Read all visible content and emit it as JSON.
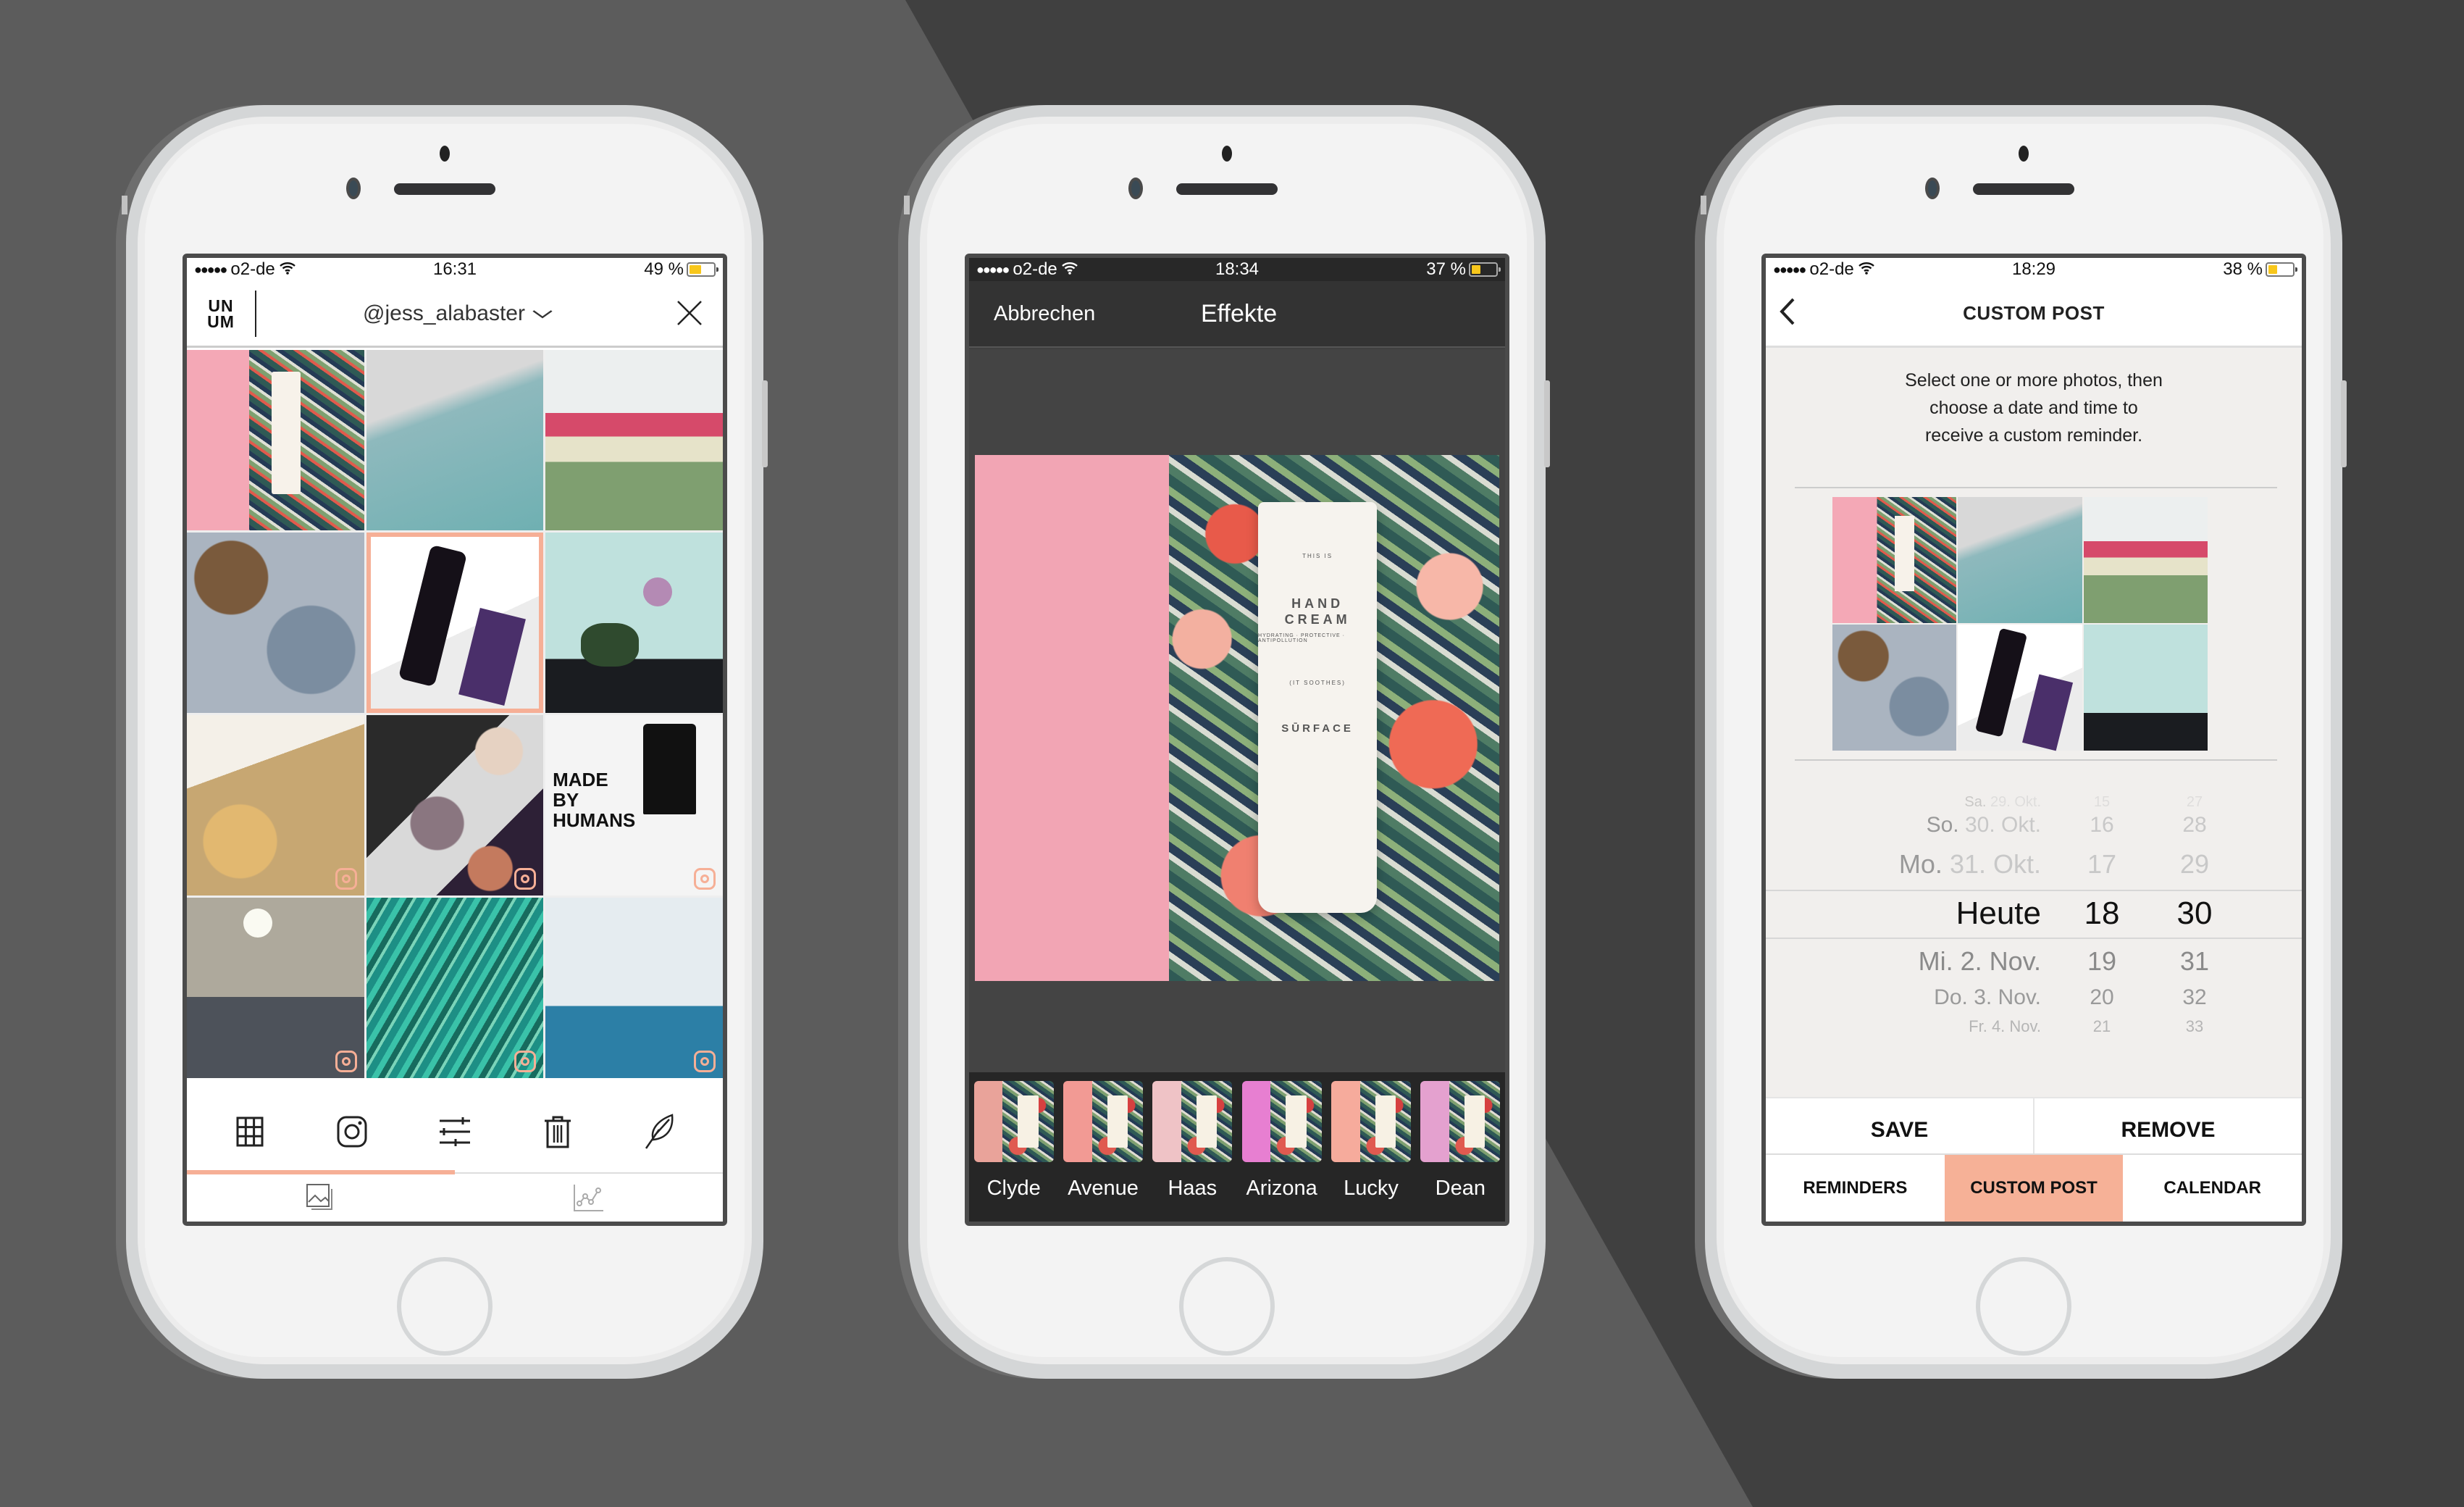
{
  "colors": {
    "accent_peach": "#f6af96",
    "background_light": "#5c5c5c",
    "background_dark": "#404040",
    "battery_fill": "#f8c71b"
  },
  "phones": [
    {
      "status": {
        "carrier": "o2-de",
        "signal_dots": "●●●●●",
        "time": "16:31",
        "battery_text": "49 %",
        "battery_level": 0.49
      },
      "header": {
        "logo_top": "UN",
        "logo_bottom": "UM",
        "account": "@jess_alabaster",
        "account_chevron": "chevron-down-icon",
        "close_icon": "close-icon"
      },
      "grid": {
        "cells": [
          {
            "name": "hand-cream-tropical",
            "selected": false,
            "instagram": false
          },
          {
            "name": "ocean-rock",
            "selected": false,
            "instagram": false
          },
          {
            "name": "juice-bottles-fan",
            "selected": false,
            "instagram": false
          },
          {
            "name": "dog-knitting",
            "selected": false,
            "instagram": false
          },
          {
            "name": "amly-face-mist",
            "selected": true,
            "instagram": false
          },
          {
            "name": "flowers-table",
            "selected": false,
            "instagram": false
          },
          {
            "name": "baldini-perfume",
            "selected": false,
            "instagram": true
          },
          {
            "name": "makeup-marble",
            "selected": false,
            "instagram": true
          },
          {
            "name": "made-by-humans-boot",
            "selected": false,
            "instagram": true
          },
          {
            "name": "lamp-sofa",
            "selected": false,
            "instagram": true
          },
          {
            "name": "monstera-leaves",
            "selected": false,
            "instagram": true
          },
          {
            "name": "ocean-waves",
            "selected": false,
            "instagram": true
          }
        ]
      },
      "toolbar": [
        {
          "icon": "grid-icon",
          "label": "Grid"
        },
        {
          "icon": "instagram-icon",
          "label": "Instagram"
        },
        {
          "icon": "sliders-icon",
          "label": "Adjust"
        },
        {
          "icon": "trash-icon",
          "label": "Delete"
        },
        {
          "icon": "feather-icon",
          "label": "Edit"
        }
      ],
      "tabs": [
        {
          "icon": "photos-icon",
          "active": true
        },
        {
          "icon": "stats-icon",
          "active": false
        }
      ]
    },
    {
      "status": {
        "carrier": "o2-de",
        "signal_dots": "●●●●●",
        "time": "18:34",
        "battery_text": "37 %",
        "battery_level": 0.37
      },
      "header": {
        "cancel": "Abbrechen",
        "title": "Effekte"
      },
      "photo": {
        "product_top": "THIS IS",
        "product_name": "HAND CREAM",
        "product_sub": "HYDRATING · PROTECTIVE · ANTIPOLLUTION",
        "product_tag": "(IT SOOTHES)",
        "brand": "SŪRFACE"
      },
      "filters": [
        {
          "name": "Clyde",
          "tint": "#e9a39a"
        },
        {
          "name": "Avenue",
          "tint": "#f29a94"
        },
        {
          "name": "Haas",
          "tint": "#efc3c6"
        },
        {
          "name": "Arizona",
          "tint": "#e77fd1"
        },
        {
          "name": "Lucky",
          "tint": "#f6ab9c"
        },
        {
          "name": "Dean",
          "tint": "#e4a1cf"
        }
      ]
    },
    {
      "status": {
        "carrier": "o2-de",
        "signal_dots": "●●●●●",
        "time": "18:29",
        "battery_text": "38 %",
        "battery_level": 0.38
      },
      "header": {
        "back_icon": "back-chevron-icon",
        "title": "CUSTOM POST"
      },
      "description": [
        "Select one or more photos, then",
        "choose a date and time to",
        "receive a custom reminder."
      ],
      "picker": {
        "rows": [
          {
            "weekday": "Sa.",
            "date": "29. Okt.",
            "hour": "15",
            "minute": "27"
          },
          {
            "weekday": "So.",
            "date": "30. Okt.",
            "hour": "16",
            "minute": "28"
          },
          {
            "weekday": "Mo.",
            "date": "31. Okt.",
            "hour": "17",
            "minute": "29"
          },
          {
            "weekday": "",
            "date": "Heute",
            "hour": "18",
            "minute": "30",
            "selected": true
          },
          {
            "weekday": "Mi.",
            "date": "2. Nov.",
            "hour": "19",
            "minute": "31"
          },
          {
            "weekday": "Do.",
            "date": "3. Nov.",
            "hour": "20",
            "minute": "32"
          },
          {
            "weekday": "Fr.",
            "date": "4. Nov.",
            "hour": "21",
            "minute": "33"
          }
        ]
      },
      "actions": {
        "save": "SAVE",
        "remove": "REMOVE"
      },
      "tabs": [
        {
          "label": "REMINDERS",
          "active": false
        },
        {
          "label": "CUSTOM POST",
          "active": true
        },
        {
          "label": "CALENDAR",
          "active": false
        }
      ]
    }
  ]
}
